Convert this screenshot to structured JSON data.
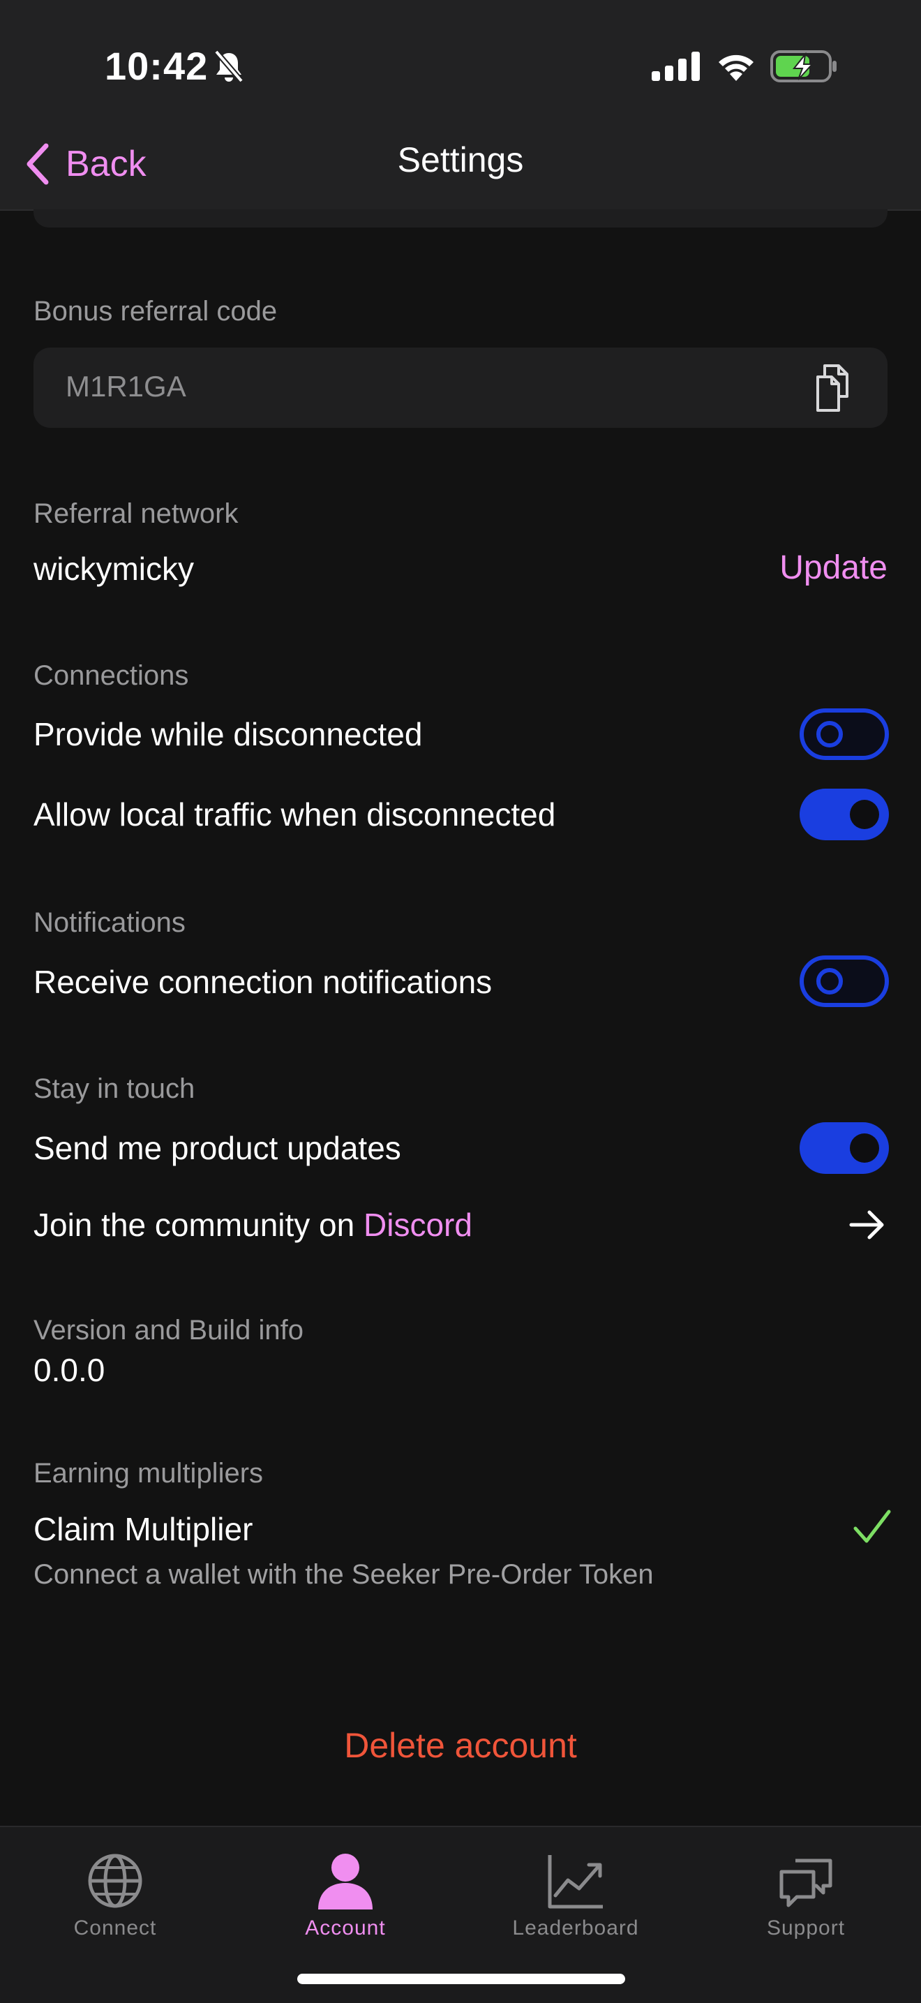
{
  "status_bar": {
    "time": "10:42"
  },
  "nav": {
    "back_label": "Back",
    "title": "Settings"
  },
  "referral_code": {
    "label": "Bonus referral code",
    "value": "M1R1GA"
  },
  "referral_network": {
    "label": "Referral network",
    "name": "wickymicky",
    "action": "Update"
  },
  "connections": {
    "label": "Connections",
    "items": [
      {
        "label": "Provide while disconnected",
        "enabled": false
      },
      {
        "label": "Allow local traffic when disconnected",
        "enabled": true
      }
    ]
  },
  "notifications": {
    "label": "Notifications",
    "items": [
      {
        "label": "Receive connection notifications",
        "enabled": false
      }
    ]
  },
  "stay_in_touch": {
    "label": "Stay in touch",
    "product_updates": {
      "label": "Send me product updates",
      "enabled": true
    },
    "community": {
      "prefix": "Join the community on ",
      "link": "Discord"
    }
  },
  "version": {
    "label": "Version and Build info",
    "value": "0.0.0"
  },
  "multipliers": {
    "label": "Earning multipliers",
    "title": "Claim Multiplier",
    "description": "Connect a wallet with the Seeker Pre-Order Token",
    "claimed": true
  },
  "delete_account": "Delete account",
  "tabs": [
    {
      "label": "Connect",
      "icon": "globe-icon",
      "active": false
    },
    {
      "label": "Account",
      "icon": "user-icon",
      "active": true
    },
    {
      "label": "Leaderboard",
      "icon": "chart-icon",
      "active": false
    },
    {
      "label": "Support",
      "icon": "chat-icon",
      "active": false
    }
  ],
  "colors": {
    "accent_pink": "#f08ef0",
    "toggle_blue": "#1a3ee0",
    "danger": "#f0553a",
    "success": "#7ddf64",
    "background": "#121212"
  }
}
